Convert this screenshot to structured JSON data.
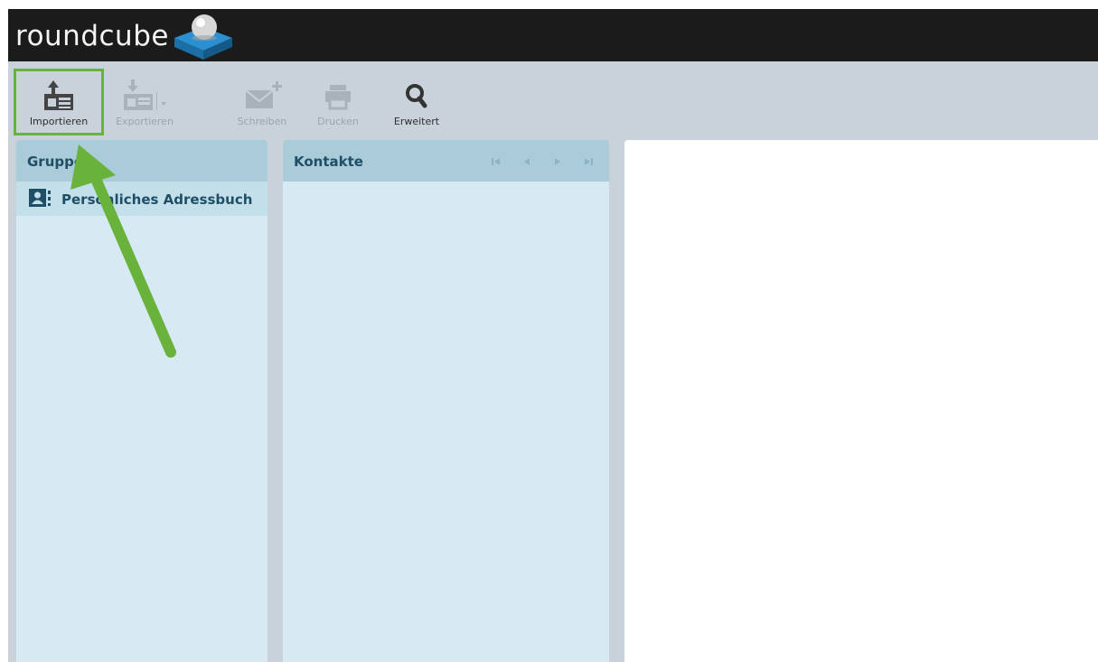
{
  "header": {
    "logo_text": "roundcube"
  },
  "toolbar": {
    "import_label": "Importieren",
    "export_label": "Exportieren",
    "compose_label": "Schreiben",
    "print_label": "Drucken",
    "advanced_label": "Erweitert"
  },
  "groups_panel": {
    "title": "Gruppen",
    "items": [
      {
        "label": "Persönliches Adressbuch"
      }
    ]
  },
  "contacts_panel": {
    "title": "Kontakte"
  },
  "icons": {
    "import": "import-icon",
    "export": "export-icon",
    "compose": "compose-mail-icon",
    "print": "print-icon",
    "search": "search-icon",
    "addressbook": "addressbook-icon",
    "pager_first": "first-page-icon",
    "pager_prev": "prev-page-icon",
    "pager_next": "next-page-icon",
    "pager_last": "last-page-icon",
    "annotation": "annotation-arrow-icon"
  },
  "colors": {
    "header_bg": "#1b1b1b",
    "panel_bg": "#d7e9f2",
    "panel_head_bg": "#aacbd8",
    "highlight_green": "#67b33d",
    "text_blue": "#1f4f66"
  }
}
